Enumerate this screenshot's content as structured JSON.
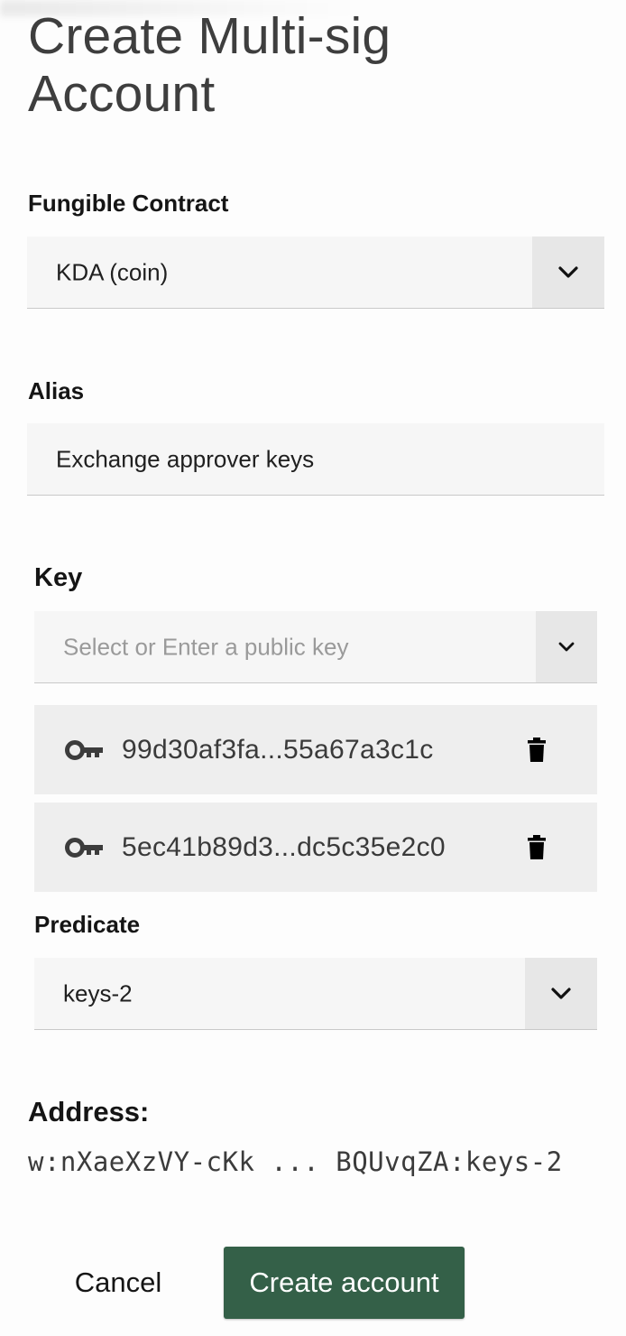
{
  "page": {
    "title_line1": "Create Multi-sig",
    "title_line2": "Account"
  },
  "fungible_contract": {
    "label": "Fungible Contract",
    "selected": "KDA (coin)"
  },
  "alias": {
    "label": "Alias",
    "value": "Exchange approver keys"
  },
  "key": {
    "label": "Key",
    "placeholder": "Select or Enter a public key",
    "items": [
      {
        "value": "99d30af3fa...55a67a3c1c"
      },
      {
        "value": "5ec41b89d3...dc5c35e2c0"
      }
    ]
  },
  "predicate": {
    "label": "Predicate",
    "selected": "keys-2"
  },
  "address": {
    "label": "Address:",
    "value": "w:nXaeXzVY-cKk ... BQUvqZA:keys-2"
  },
  "actions": {
    "cancel_label": "Cancel",
    "create_label": "Create account"
  },
  "colors": {
    "primary": "#346048",
    "field_bg": "#f6f6f6",
    "key_item_bg": "#eeeeee"
  },
  "icons": [
    "chevron-down-icon",
    "key-icon",
    "trash-icon"
  ]
}
